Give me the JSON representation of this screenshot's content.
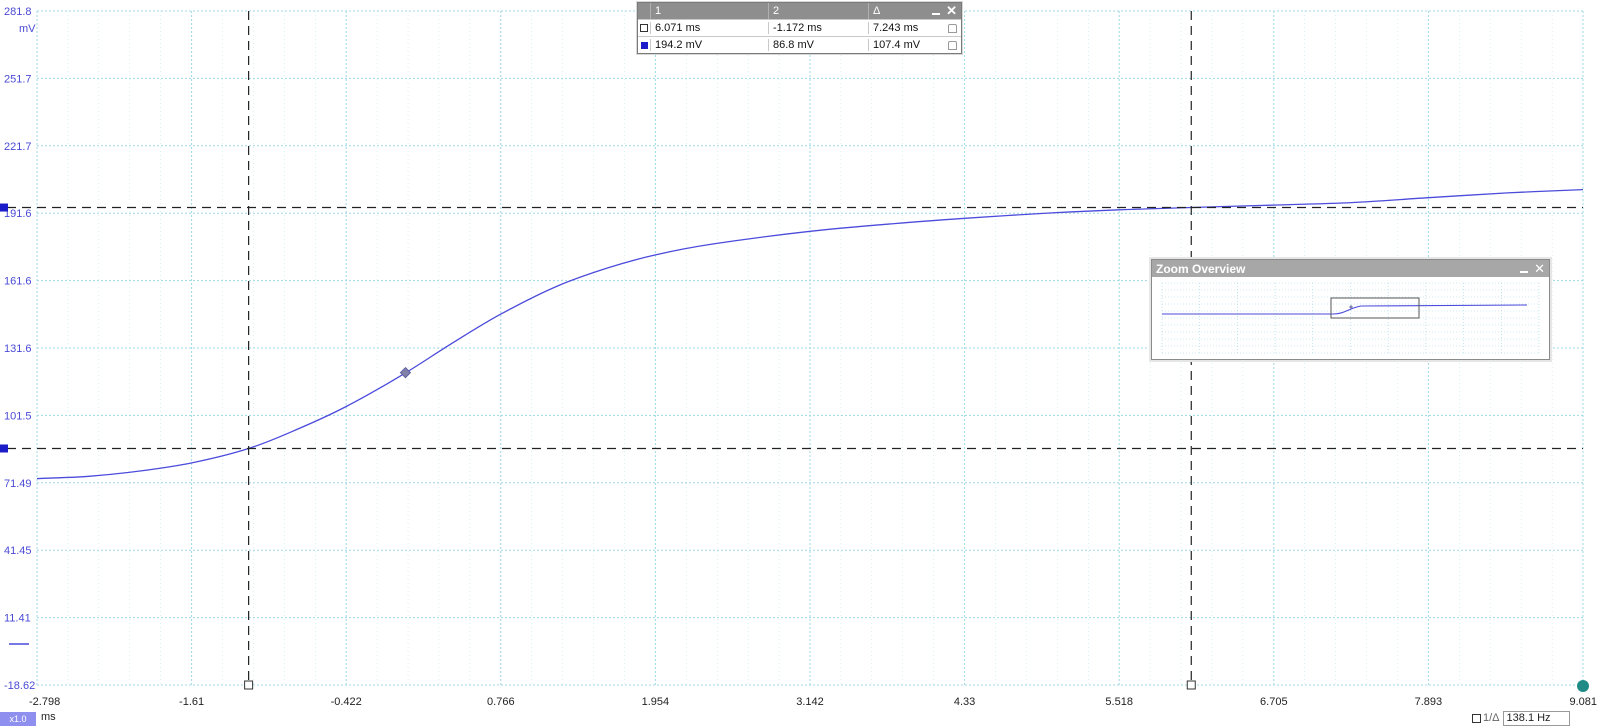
{
  "chart_data": {
    "type": "line",
    "title": "",
    "xlabel": "ms",
    "ylabel": "mV",
    "xlim": [
      -2.798,
      9.081
    ],
    "ylim": [
      -18.62,
      281.8
    ],
    "x_ticks": [
      "-2.798",
      "-1.61",
      "-0.422",
      "0.766",
      "1.954",
      "3.142",
      "4.33",
      "5.518",
      "6.705",
      "7.893",
      "9.081"
    ],
    "y_ticks": [
      "281.8",
      "251.7",
      "221.7",
      "191.6",
      "161.6",
      "131.6",
      "101.5",
      "71.49",
      "41.45",
      "11.41",
      "-18.62"
    ],
    "grid": true,
    "series": [
      {
        "color": "#4b4bdc",
        "x": [
          -2.798,
          -2.4,
          -2.0,
          -1.6,
          -1.172,
          -0.8,
          -0.422,
          0.0,
          0.4,
          0.766,
          1.2,
          1.6,
          1.954,
          2.4,
          3.142,
          3.8,
          4.33,
          5.0,
          5.518,
          6.071,
          6.705,
          7.3,
          7.893,
          8.5,
          9.081
        ],
        "y": [
          73.4,
          74.4,
          76.8,
          80.5,
          86.8,
          95.3,
          105.5,
          119.3,
          134.0,
          146.7,
          159.2,
          167.5,
          173.1,
          178.0,
          183.6,
          187.1,
          189.4,
          191.8,
          193.2,
          194.2,
          195.3,
          196.4,
          198.6,
          200.7,
          202.2
        ]
      }
    ],
    "marker": {
      "x": 0.033,
      "y": 120.6
    }
  },
  "cursors": {
    "vertical": [
      -1.172,
      6.071
    ],
    "horizontal": [
      86.8,
      194.2
    ]
  },
  "cursor_table": {
    "header": {
      "col1": "1",
      "col2": "2",
      "col3": "Δ"
    },
    "rows": [
      {
        "v1": "6.071 ms",
        "v2": "-1.172 ms",
        "delta": "7.243 ms"
      },
      {
        "v1": "194.2 mV",
        "v2": "86.8 mV",
        "delta": "107.4 mV"
      }
    ]
  },
  "zoom_overview": {
    "title": "Zoom Overview"
  },
  "scale_badge": "x1.0",
  "x_unit": "ms",
  "y_unit": "mV",
  "frequency": {
    "label": "1/Δ",
    "value": "138.1 Hz"
  },
  "colors": {
    "trace": "#4b4bdc",
    "grid": "#9fd8e6",
    "cursor": "#222222",
    "axis_text": "#4a4ad6"
  }
}
